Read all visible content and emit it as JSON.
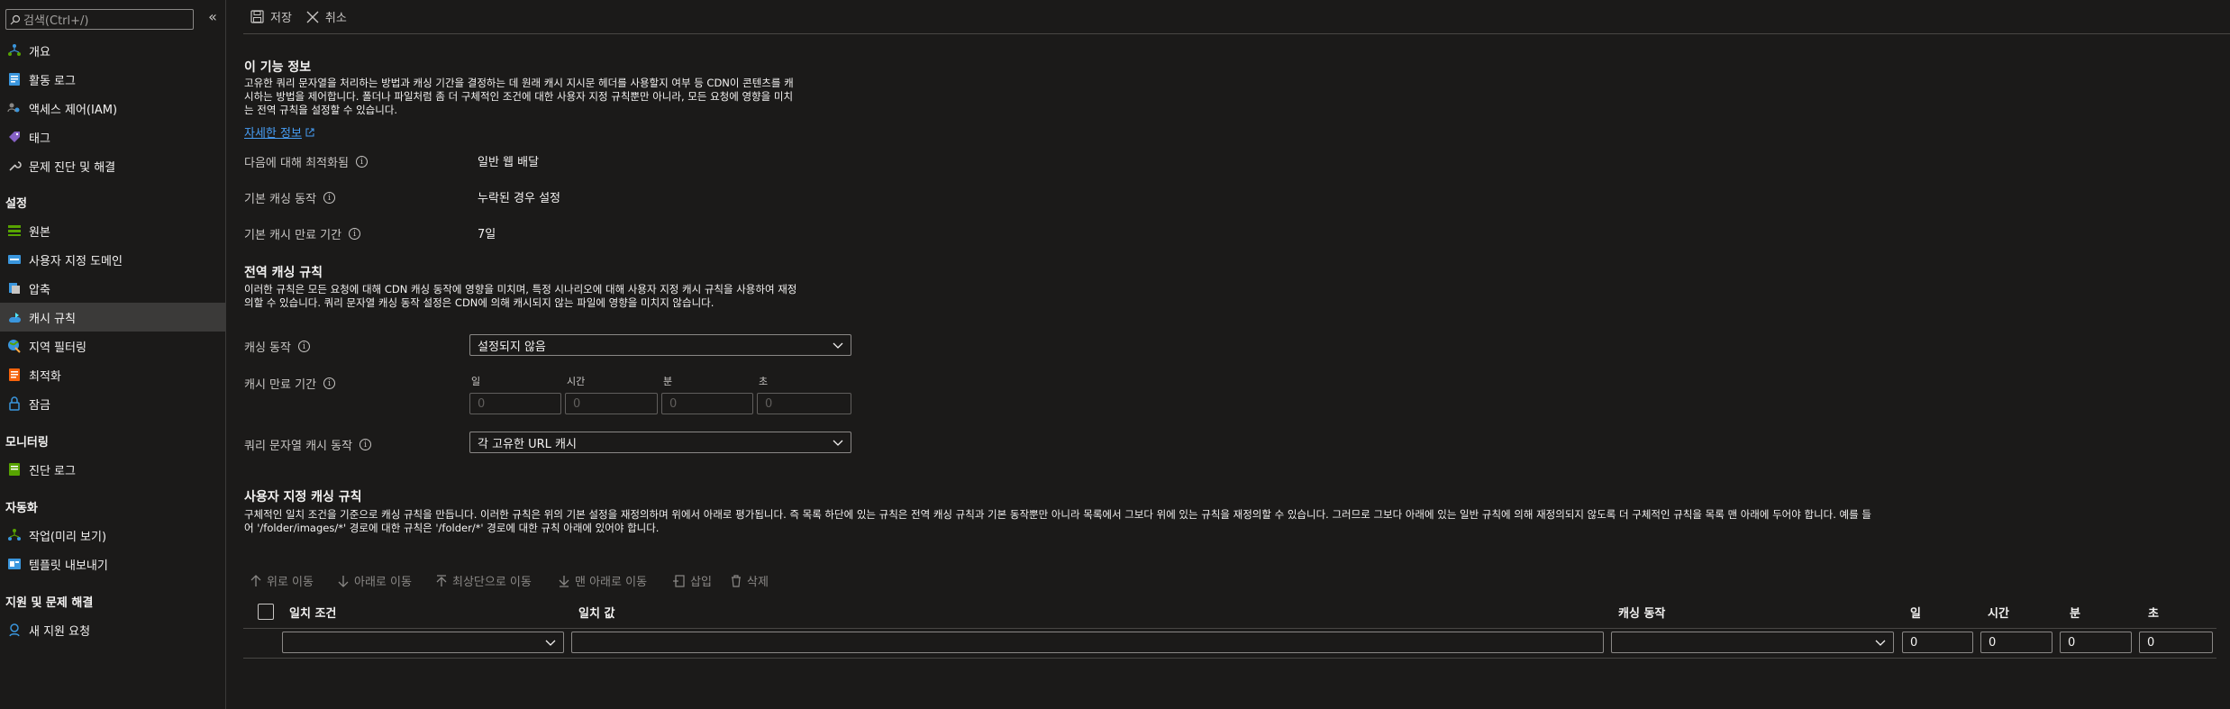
{
  "sidebar": {
    "search_placeholder": "검색(Ctrl+/)",
    "collapse_glyph": "«",
    "items_top": [
      {
        "label": "개요",
        "icon": "overview-icon"
      },
      {
        "label": "활동 로그",
        "icon": "activity-log-icon"
      },
      {
        "label": "액세스 제어(IAM)",
        "icon": "iam-icon"
      },
      {
        "label": "태그",
        "icon": "tag-icon"
      },
      {
        "label": "문제 진단 및 해결",
        "icon": "wrench-icon"
      }
    ],
    "section_settings": "설정",
    "items_settings": [
      {
        "label": "원본",
        "icon": "origin-icon"
      },
      {
        "label": "사용자 지정 도메인",
        "icon": "custom-domain-icon"
      },
      {
        "label": "압축",
        "icon": "compression-icon"
      },
      {
        "label": "캐시 규칙",
        "icon": "cache-rules-icon"
      },
      {
        "label": "지역 필터링",
        "icon": "geo-filter-icon"
      },
      {
        "label": "최적화",
        "icon": "optimization-icon"
      },
      {
        "label": "잠금",
        "icon": "lock-icon"
      }
    ],
    "section_monitoring": "모니터링",
    "items_monitoring": [
      {
        "label": "진단 로그",
        "icon": "diagnostic-log-icon"
      }
    ],
    "section_automation": "자동화",
    "items_automation": [
      {
        "label": "작업(미리 보기)",
        "icon": "tasks-icon"
      },
      {
        "label": "템플릿 내보내기",
        "icon": "export-template-icon"
      }
    ],
    "section_support": "지원 및 문제 해결",
    "items_support": [
      {
        "label": "새 지원 요청",
        "icon": "support-request-icon"
      }
    ]
  },
  "toolbar": {
    "save_label": "저장",
    "cancel_label": "취소"
  },
  "feature_info": {
    "title": "이 기능 정보",
    "line1": "고유한 쿼리 문자열을 처리하는 방법과 캐싱 기간을 결정하는 데 원래 캐시 지시문 헤더를 사용할지 여부 등 CDN이 콘텐츠를 캐",
    "line2": "시하는 방법을 제어합니다. 폴더나 파일처럼 좀 더 구체적인 조건에 대한 사용자 지정 규칙뿐만 아니라, 모든 요청에 영향을 미치",
    "line3": "는 전역 규칙을 설정할 수 있습니다.",
    "learn_more": "자세한 정보",
    "optimized_for_label": "다음에 대해 최적화됨",
    "optimized_for_value": "일반 웹 배달",
    "default_caching_label": "기본 캐싱 동작",
    "default_caching_value": "누락된 경우 설정",
    "default_expiry_label": "기본 캐시 만료 기간",
    "default_expiry_value": "7일"
  },
  "global_rules": {
    "title": "전역 캐싱 규칙",
    "line1": "이러한 규칙은 모든 요청에 대해 CDN 캐싱 동작에 영향을 미치며, 특정 시나리오에 대해 사용자 지정 캐시 규칙을 사용하여 재정",
    "line2": "의할 수 있습니다. 쿼리 문자열 캐싱 동작 설정은 CDN에 의해 캐시되지 않는 파일에 영향을 미치지 않습니다.",
    "caching_behavior_label": "캐싱 동작",
    "caching_behavior_value": "설정되지 않음",
    "cache_expiry_label": "캐시 만료 기간",
    "expiry_units": [
      "일",
      "시간",
      "분",
      "초"
    ],
    "expiry_values": [
      "0",
      "0",
      "0",
      "0"
    ],
    "query_string_label": "쿼리 문자열 캐시 동작",
    "query_string_value": "각 고유한 URL 캐시"
  },
  "custom_rules": {
    "title": "사용자 지정 캐싱 규칙",
    "line1": "구체적인 일치 조건을 기준으로 캐싱 규칙을 만듭니다. 이러한 규칙은 위의 기본 설정을 재정의하며 위에서 아래로 평가됩니다. 즉 목록 하단에 있는 규칙은 전역 캐싱 규칙과 기본 동작뿐만 아니라 목록에서 그보다 위에 있는 규칙을 재정의할 수 있습니다. 그러므로 그보다 아래에 있는 일반 규칙에 의해 재정의되지 않도록 더 구체적인 규칙을 목록 맨 아래에 두어야 합니다. 예를 들",
    "line2": "어 '/folder/images/*' 경로에 대한 규칙은 '/folder/*' 경로에 대한 규칙 아래에 있어야 합니다.",
    "actions": {
      "move_up": "위로 이동",
      "move_down": "아래로 이동",
      "move_top": "최상단으로 이동",
      "move_bottom": "맨 아래로 이동",
      "insert": "삽입",
      "delete": "삭제"
    },
    "columns": {
      "match_condition": "일치 조건",
      "match_value": "일치 값",
      "caching_behavior": "캐싱 동작",
      "days": "일",
      "hours": "시간",
      "minutes": "분",
      "seconds": "초"
    },
    "row_values": [
      "0",
      "0",
      "0",
      "0"
    ]
  }
}
